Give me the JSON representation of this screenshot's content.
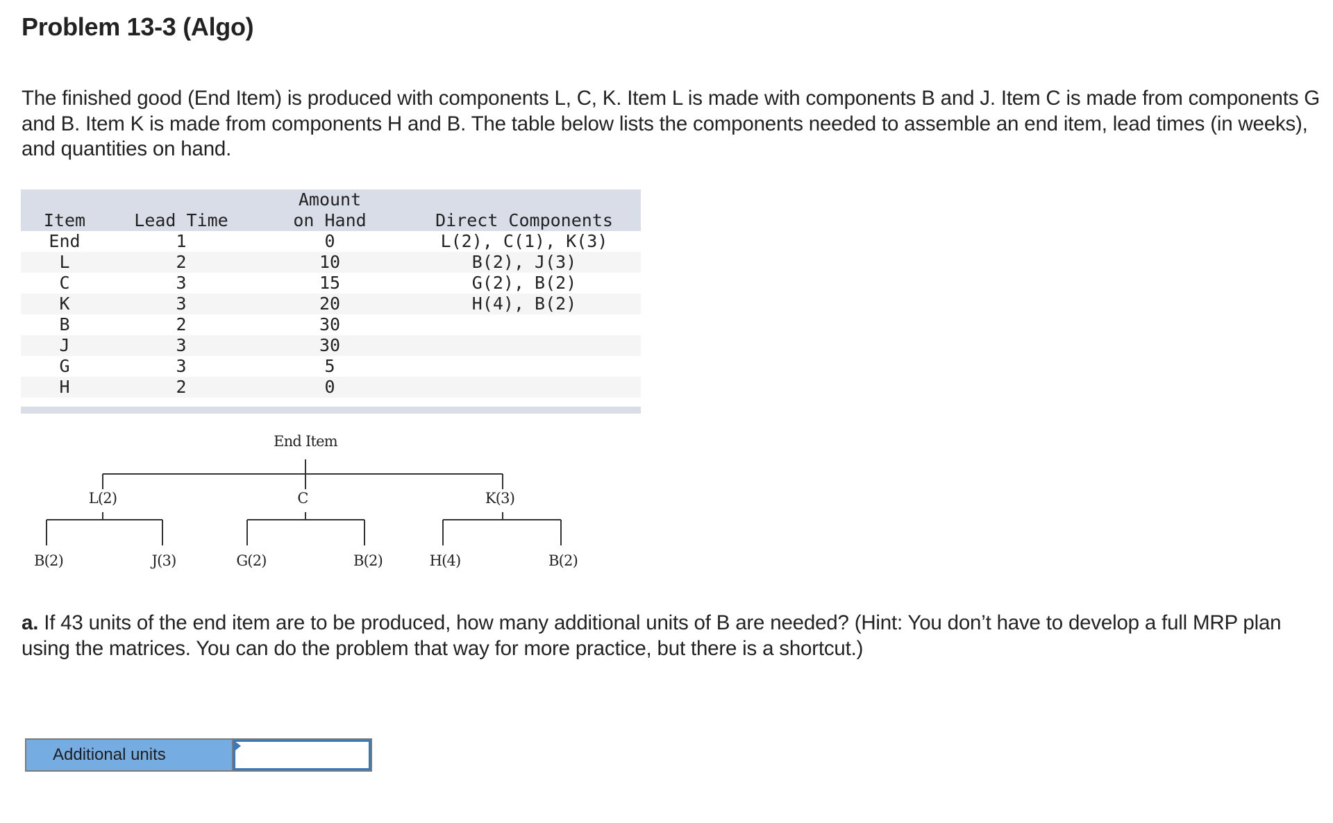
{
  "title": "Problem 13-3 (Algo)",
  "intro": "The finished good (End Item) is produced with components L, C, K. Item L is made with components B and J. Item C is made from components G and B. Item K is made from components H and B. The table below lists the components needed to assemble an end item, lead times (in weeks), and quantities on hand.",
  "table": {
    "headers": {
      "item": "Item",
      "lead_time": "Lead Time",
      "amount_line1": "Amount",
      "amount_line2": "on Hand",
      "direct": "Direct Components"
    },
    "rows": [
      {
        "item": "End",
        "lead_time": "1",
        "on_hand": "0",
        "direct": "L(2), C(1), K(3)"
      },
      {
        "item": "L",
        "lead_time": "2",
        "on_hand": "10",
        "direct": "B(2), J(3)"
      },
      {
        "item": "C",
        "lead_time": "3",
        "on_hand": "15",
        "direct": "G(2), B(2)"
      },
      {
        "item": "K",
        "lead_time": "3",
        "on_hand": "20",
        "direct": "H(4), B(2)"
      },
      {
        "item": "B",
        "lead_time": "2",
        "on_hand": "30",
        "direct": ""
      },
      {
        "item": "J",
        "lead_time": "3",
        "on_hand": "30",
        "direct": ""
      },
      {
        "item": "G",
        "lead_time": "3",
        "on_hand": "5",
        "direct": ""
      },
      {
        "item": "H",
        "lead_time": "2",
        "on_hand": "0",
        "direct": ""
      }
    ]
  },
  "tree": {
    "root": "End Item",
    "level1": [
      "L(2)",
      "C",
      "K(3)"
    ],
    "level2": [
      "B(2)",
      "J(3)",
      "G(2)",
      "B(2)",
      "H(4)",
      "B(2)"
    ]
  },
  "question": {
    "prefix": "a.",
    "text": " If 43 units of the end item are to be produced, how many additional units of B are needed? (Hint: You don’t have to develop a full MRP plan using the matrices. You can do the problem that way for more practice, but there is a shortcut.)"
  },
  "answer": {
    "label": "Additional units",
    "value": ""
  }
}
